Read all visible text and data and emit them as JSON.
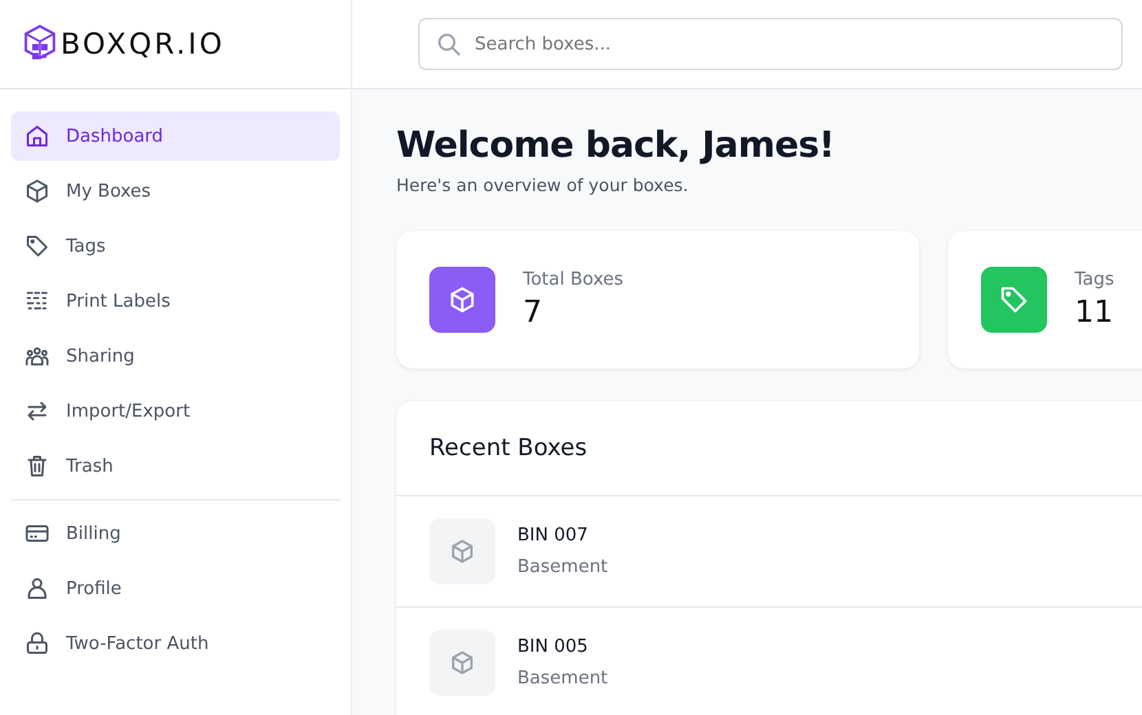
{
  "logo": {
    "text": "BOXQR.IO"
  },
  "search": {
    "placeholder": "Search boxes..."
  },
  "sidebar": {
    "main_items": [
      {
        "label": "Dashboard",
        "selected": true
      },
      {
        "label": "My Boxes",
        "selected": false
      },
      {
        "label": "Tags",
        "selected": false
      },
      {
        "label": "Print Labels",
        "selected": false
      },
      {
        "label": "Sharing",
        "selected": false
      },
      {
        "label": "Import/Export",
        "selected": false
      },
      {
        "label": "Trash",
        "selected": false
      }
    ],
    "account_items": [
      {
        "label": "Billing",
        "selected": false
      },
      {
        "label": "Profile",
        "selected": false
      },
      {
        "label": "Two-Factor Auth",
        "selected": false
      }
    ]
  },
  "welcome": {
    "title": "Welcome back, James!",
    "subtitle": "Here's an overview of your boxes."
  },
  "stats": [
    {
      "label": "Total Boxes",
      "value": "7",
      "color": "#8b5cf6"
    },
    {
      "label": "Tags",
      "value": "11",
      "color": "#22c55e"
    }
  ],
  "recent_boxes": {
    "title": "Recent Boxes",
    "items": [
      {
        "name": "BIN 007",
        "location": "Basement"
      },
      {
        "name": "BIN 005",
        "location": "Basement"
      }
    ]
  }
}
